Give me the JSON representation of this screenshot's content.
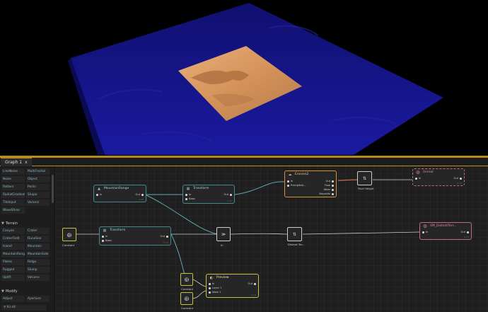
{
  "graph_tab": {
    "label": "Graph 1",
    "close_glyph": "x"
  },
  "library": {
    "items_top": [
      [
        "LineNoise",
        "MultiFractal"
      ],
      [
        "Noise",
        "Object"
      ],
      [
        "Pattern",
        "Perlin"
      ],
      [
        "RadialGradient",
        "Shape"
      ],
      [
        "TileInput",
        "Voronoi"
      ],
      [
        "WaveShine",
        ""
      ]
    ],
    "sections": [
      {
        "name": "Terrain",
        "items": [
          [
            "Canyon",
            "Crater"
          ],
          [
            "CraterField",
            "DuneSea"
          ],
          [
            "Island",
            "Mountain"
          ],
          [
            "MountainRange",
            "MountainSide"
          ],
          [
            "Plates",
            "Ridge"
          ],
          [
            "Rugged",
            "Slump"
          ],
          [
            "Uplift",
            "Volcano"
          ]
        ]
      },
      {
        "name": "Modify",
        "items": [
          [
            "Adjust",
            "Aperture"
          ]
        ]
      }
    ],
    "zoom_text": "93.44"
  },
  "nodes": {
    "mountain_range": {
      "title": "MountainRange",
      "in": "In",
      "out": "Out",
      "version": "0.15"
    },
    "transform_a": {
      "title": "Transform",
      "in": "In",
      "base": "Base",
      "out": "Out",
      "version": "0.15"
    },
    "erosion": {
      "title": "Erosion2",
      "ports_in": [
        "In",
        "Precipitati..."
      ],
      "ports_out": [
        "Out",
        "Flow",
        "Wear",
        "Deposits"
      ],
      "version": "0.15"
    },
    "final_height": {
      "caption": "Final Height"
    },
    "unreal": {
      "title": "Unreal",
      "in": "In",
      "out": "Out",
      "version": "0.15"
    },
    "constant_a": {
      "caption": "Constant"
    },
    "transform_b": {
      "title": "Transform",
      "in": "In",
      "base": "Base",
      "out": "Out",
      "version": "0.15"
    },
    "combine": {
      "caption": "In"
    },
    "distant_terrain_small": {
      "caption": "Distant Ter..."
    },
    "sm_distant": {
      "title": "SM_DistantTerr...",
      "in": "In",
      "out": "Out",
      "version": "0.15"
    },
    "constant_b": {
      "caption": "Constant"
    },
    "constant_c": {
      "caption": "Constant"
    },
    "preview": {
      "title": "Preview",
      "ports_in": [
        "In",
        "Layer 1",
        "Mask 1"
      ],
      "out": "Out",
      "version": "0.15"
    }
  },
  "colors": {
    "ocean": "#14148c",
    "terrain": "#d99a62",
    "accent": "#b58a1e",
    "node_teal": "#3f8a8e",
    "node_orange": "#d9903a",
    "node_pink": "#c06a80",
    "node_yellow": "#c8c040"
  }
}
